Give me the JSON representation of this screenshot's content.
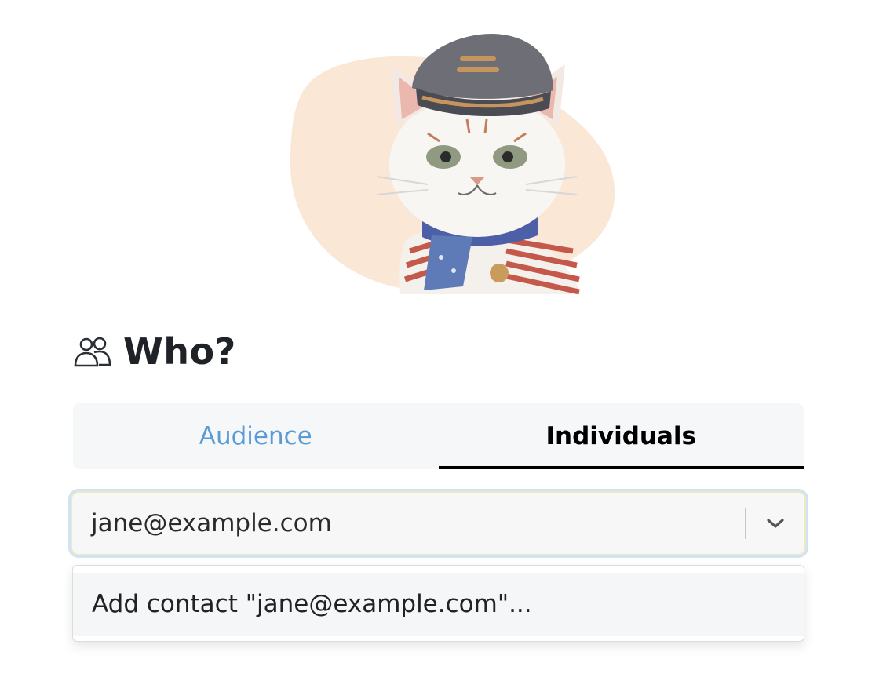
{
  "heading": {
    "title": "Who?",
    "icon": "people-icon"
  },
  "tabs": [
    {
      "label": "Audience",
      "active": false
    },
    {
      "label": "Individuals",
      "active": true
    }
  ],
  "recipient_select": {
    "value": "jane@example.com",
    "icon": "chevron-down-icon"
  },
  "dropdown": {
    "options": [
      {
        "label": "Add contact \"jane@example.com\"..."
      }
    ]
  },
  "colors": {
    "tab_inactive": "#5a9bd5",
    "tab_active": "#000000",
    "focus_ring": "#cfe2f7",
    "blob": "#fbe7d6"
  }
}
